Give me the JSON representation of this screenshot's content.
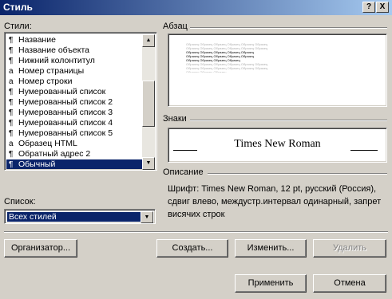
{
  "window": {
    "title": "Стиль",
    "help_label": "?",
    "close_label": "X"
  },
  "styles": {
    "label": "Стили:",
    "items": [
      {
        "mark": "¶",
        "name": "Название"
      },
      {
        "mark": "¶",
        "name": "Название объекта"
      },
      {
        "mark": "¶",
        "name": "Нижний колонтитул"
      },
      {
        "mark": "a",
        "name": "Номер страницы"
      },
      {
        "mark": "a",
        "name": "Номер строки"
      },
      {
        "mark": "¶",
        "name": "Нумерованный список"
      },
      {
        "mark": "¶",
        "name": "Нумерованный список 2"
      },
      {
        "mark": "¶",
        "name": "Нумерованный список 3"
      },
      {
        "mark": "¶",
        "name": "Нумерованный список 4"
      },
      {
        "mark": "¶",
        "name": "Нумерованный список 5"
      },
      {
        "mark": "a",
        "name": "Образец HTML"
      },
      {
        "mark": "¶",
        "name": "Обратный адрес 2"
      },
      {
        "mark": "¶",
        "name": "Обычный"
      }
    ],
    "selected_index": 12,
    "scroll_up_icon": "triangle-up-icon",
    "scroll_down_icon": "triangle-down-icon"
  },
  "list_filter": {
    "label": "Список:",
    "value": "Всех стилей",
    "dropdown_icon": "triangle-down-icon"
  },
  "paragraph": {
    "label": "Абзац",
    "sample_word": "Образец"
  },
  "characters": {
    "label": "Знаки",
    "sample": "Times New Roman"
  },
  "description": {
    "label": "Описание",
    "text": "Шрифт: Times New Roman, 12 pt, русский (Россия), сдвиг влево, междустр.интервал одинарный, запрет висячих строк"
  },
  "buttons": {
    "organizer": "Организатор...",
    "create": "Создать...",
    "modify": "Изменить...",
    "delete": "Удалить",
    "apply": "Применить",
    "cancel": "Отмена"
  }
}
